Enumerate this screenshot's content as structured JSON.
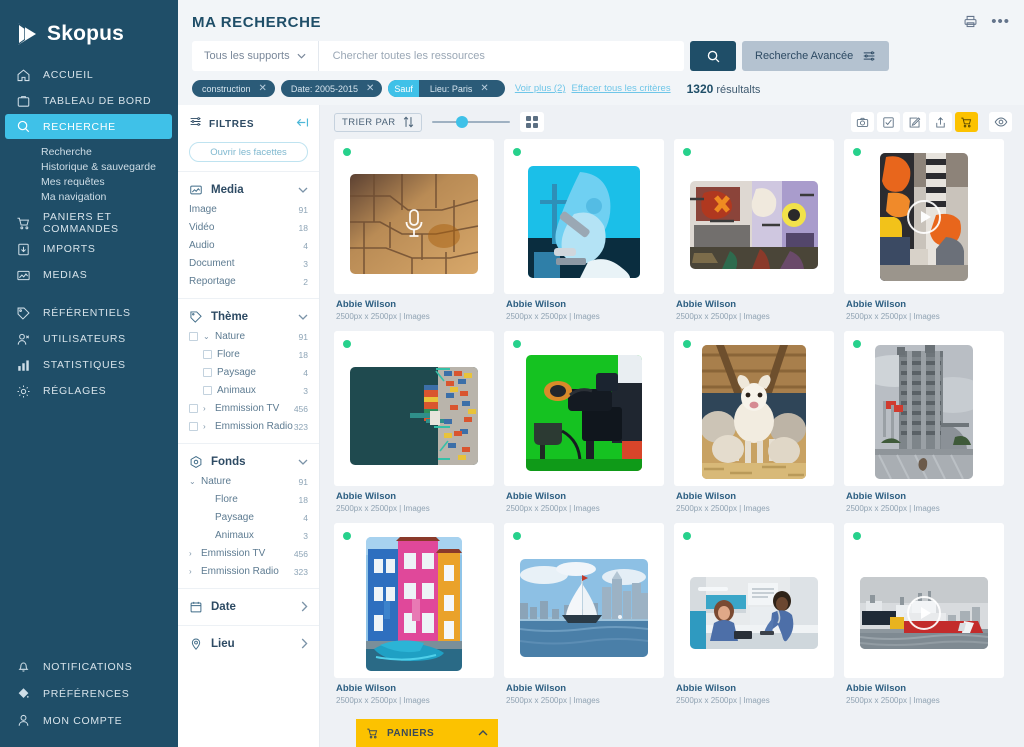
{
  "brand": {
    "name": "Skopus",
    "logo_icon": "play-triangle-logo"
  },
  "sidebar": {
    "items": [
      {
        "label": "ACCUEIL",
        "icon": "home-icon"
      },
      {
        "label": "TABLEAU DE BORD",
        "icon": "dashboard-icon"
      },
      {
        "label": "RECHERCHE",
        "icon": "search-icon",
        "active": true
      }
    ],
    "submenu": [
      "Recherche",
      "Historique & sauvegarde",
      "Mes requêtes",
      "Ma navigation"
    ],
    "items2": [
      {
        "label": "PANIERS ET COMMANDES",
        "icon": "cart-icon"
      },
      {
        "label": "IMPORTS",
        "icon": "import-icon"
      },
      {
        "label": "MEDIAS",
        "icon": "media-icon"
      }
    ],
    "items3": [
      {
        "label": "RÉFÉRENTIELS",
        "icon": "tag-icon"
      },
      {
        "label": "UTILISATEURS",
        "icon": "users-icon"
      },
      {
        "label": "STATISTIQUES",
        "icon": "bar-chart-icon"
      },
      {
        "label": "RÉGLAGES",
        "icon": "gear-icon"
      }
    ],
    "bottom": [
      {
        "label": "NOTIFICATIONS",
        "icon": "bell-icon"
      },
      {
        "label": "PRÉFÉRENCES",
        "icon": "preferences-icon"
      },
      {
        "label": "MON COMPTE",
        "icon": "person-icon"
      }
    ]
  },
  "header": {
    "title": "MA RECHERCHE",
    "print_icon": "printer-icon",
    "more_icon": "more-dots-icon"
  },
  "search": {
    "support_label": "Tous les supports",
    "placeholder": "Chercher toutes les ressources",
    "value": "",
    "go_icon": "search-icon",
    "advanced_label": "Recherche Avancée",
    "advanced_icon": "sliders-icon"
  },
  "criteria": {
    "chips": [
      {
        "label": "construction",
        "exclude": false
      },
      {
        "label": "Date: 2005-2015",
        "exclude": false
      },
      {
        "label": "Lieu: Paris",
        "exclude": true,
        "exclude_label": "Sauf"
      }
    ],
    "see_more": "Voir plus (2)",
    "clear_all": "Effacer tous les critères",
    "result_count": "1320",
    "result_word": "résultalts"
  },
  "filters": {
    "title": "FILTRES",
    "collapse_icon": "collapse-left-icon",
    "open_facets": "Ouvrir les facettes",
    "sections": [
      {
        "title": "Media",
        "icon": "media-icon",
        "caret": "chevron-down-icon",
        "rows": [
          {
            "label": "Image",
            "count": "91"
          },
          {
            "label": "Vidéo",
            "count": "18"
          },
          {
            "label": "Audio",
            "count": "4"
          },
          {
            "label": "Document",
            "count": "3"
          },
          {
            "label": "Reportage",
            "count": "2"
          }
        ]
      },
      {
        "title": "Thème",
        "icon": "tag-icon",
        "caret": "chevron-down-icon",
        "rows": [
          {
            "label": "Nature",
            "count": "91",
            "checkbox": true,
            "caret": "chevron-down-icon",
            "indent": 1
          },
          {
            "label": "Flore",
            "count": "18",
            "checkbox": true,
            "indent": 2
          },
          {
            "label": "Paysage",
            "count": "4",
            "checkbox": true,
            "indent": 2
          },
          {
            "label": "Animaux",
            "count": "3",
            "checkbox": true,
            "indent": 2
          },
          {
            "label": "Emmission TV",
            "count": "456",
            "checkbox": true,
            "caret": "chevron-right-icon",
            "indent": 1
          },
          {
            "label": "Emmission Radio",
            "count": "323",
            "checkbox": true,
            "caret": "chevron-right-icon",
            "indent": 1
          }
        ]
      },
      {
        "title": "Fonds",
        "icon": "fonds-icon",
        "caret": "chevron-down-icon",
        "rows": [
          {
            "label": "Nature",
            "count": "91",
            "caret": "chevron-down-icon",
            "indent": 1
          },
          {
            "label": "Flore",
            "count": "18",
            "indent": 3
          },
          {
            "label": "Paysage",
            "count": "4",
            "indent": 3
          },
          {
            "label": "Animaux",
            "count": "3",
            "indent": 3
          },
          {
            "label": "Emmission TV",
            "count": "456",
            "caret": "chevron-right-icon",
            "indent": 1
          },
          {
            "label": "Emmission Radio",
            "count": "323",
            "caret": "chevron-right-icon",
            "indent": 1
          }
        ]
      }
    ],
    "collapsed_sections": [
      {
        "title": "Date",
        "icon": "calendar-icon",
        "caret": "chevron-right-icon"
      },
      {
        "title": "Lieu",
        "icon": "location-pin-icon",
        "caret": "chevron-right-icon"
      }
    ]
  },
  "toolbar": {
    "sort_label": "TRIER PAR",
    "sort_icon": "sort-arrows-icon",
    "slider_value": 30,
    "grid_icon": "grid-view-icon",
    "actions": [
      {
        "name": "camera-icon",
        "active": false
      },
      {
        "name": "checkbox-icon",
        "active": false
      },
      {
        "name": "edit-icon",
        "active": false
      },
      {
        "name": "share-icon",
        "active": false
      },
      {
        "name": "cart-icon",
        "active": true
      }
    ],
    "eye_icon": "eye-icon"
  },
  "results_grid": {
    "cards": [
      {
        "title": "Abbie Wilson",
        "meta": "2500px x 2500px | Images",
        "overlay": "microphone-icon",
        "shape": "landscape",
        "theme": "desert-cracked-earth"
      },
      {
        "title": "Abbie Wilson",
        "meta": "2500px x 2500px | Images",
        "overlay": "",
        "shape": "square",
        "theme": "microscope-lab"
      },
      {
        "title": "Abbie Wilson",
        "meta": "2500px x 2500px | Images",
        "overlay": "",
        "shape": "landscape",
        "theme": "graffiti-wall"
      },
      {
        "title": "Abbie Wilson",
        "meta": "2500px x 2500px | Images",
        "overlay": "play-icon",
        "shape": "portrait",
        "theme": "construction-helmets"
      },
      {
        "title": "Abbie Wilson",
        "meta": "2500px x 2500px | Images",
        "overlay": "",
        "shape": "landscape",
        "theme": "container-port-aerial"
      },
      {
        "title": "Abbie Wilson",
        "meta": "2500px x 2500px | Images",
        "overlay": "",
        "shape": "square",
        "theme": "green-screen-camera"
      },
      {
        "title": "Abbie Wilson",
        "meta": "2500px x 2500px | Images",
        "overlay": "",
        "shape": "square",
        "theme": "lambs-barn"
      },
      {
        "title": "Abbie Wilson",
        "meta": "2500px x 2500px | Images",
        "overlay": "",
        "shape": "portrait",
        "theme": "concrete-tower-building"
      },
      {
        "title": "Abbie Wilson",
        "meta": "2500px x 2500px | Images",
        "overlay": "",
        "shape": "portrait",
        "theme": "burano-colored-houses"
      },
      {
        "title": "Abbie Wilson",
        "meta": "2500px x 2500px | Images",
        "overlay": "",
        "shape": "landscape",
        "theme": "sailboat-city-skyline"
      },
      {
        "title": "Abbie Wilson",
        "meta": "2500px x 2500px | Images",
        "overlay": "",
        "shape": "landscape",
        "theme": "nurses-hospital"
      },
      {
        "title": "Abbie Wilson",
        "meta": "2500px x 2500px | Images",
        "overlay": "play-icon",
        "shape": "landscape",
        "theme": "supply-vessels-harbor"
      }
    ]
  },
  "paniers": {
    "label": "PANIERS",
    "icon": "cart-icon",
    "caret": "chevron-up-icon"
  },
  "colors": {
    "sidebar": "#1f4e68",
    "accent_cyan": "#3fc1e8",
    "accent_yellow": "#fcc200",
    "status_green": "#27d18c",
    "page_bg": "#eef1f5"
  }
}
